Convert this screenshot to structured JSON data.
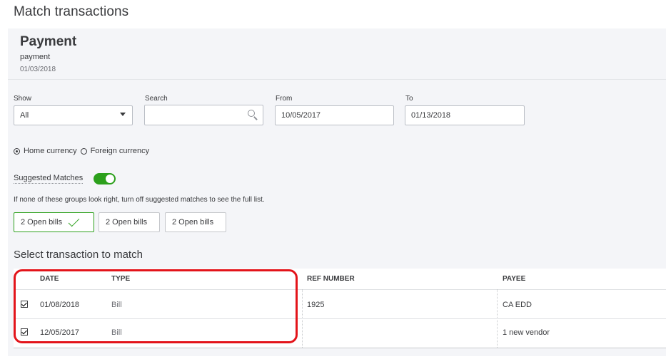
{
  "modal": {
    "title": "Match transactions"
  },
  "summary": {
    "title": "Payment",
    "subtitle": "payment",
    "date": "01/03/2018"
  },
  "filters": {
    "show_label": "Show",
    "show_value": "All",
    "search_label": "Search",
    "search_value": "",
    "from_label": "From",
    "from_value": "10/05/2017",
    "to_label": "To",
    "to_value": "01/13/2018"
  },
  "currency": {
    "home_label": "Home currency",
    "foreign_label": "Foreign currency",
    "selected": "home"
  },
  "suggested": {
    "label": "Suggested Matches",
    "enabled": true,
    "hint": "If none of these groups look right, turn off suggested matches to see the full list."
  },
  "groups": [
    {
      "label": "2 Open bills",
      "selected": true
    },
    {
      "label": "2 Open bills",
      "selected": false
    },
    {
      "label": "2 Open bills",
      "selected": false
    }
  ],
  "table": {
    "title": "Select transaction to match",
    "columns": [
      "DATE",
      "TYPE",
      "REF NUMBER",
      "PAYEE"
    ],
    "rows": [
      {
        "checked": true,
        "date": "01/08/2018",
        "type": "Bill",
        "ref": "1925",
        "payee": "CA EDD"
      },
      {
        "checked": true,
        "date": "12/05/2017",
        "type": "Bill",
        "ref": "",
        "payee": "1 new vendor"
      }
    ]
  },
  "colors": {
    "accent_green": "#2ca01c",
    "highlight_red": "#e3141a",
    "panel_bg": "#f4f5f8"
  }
}
